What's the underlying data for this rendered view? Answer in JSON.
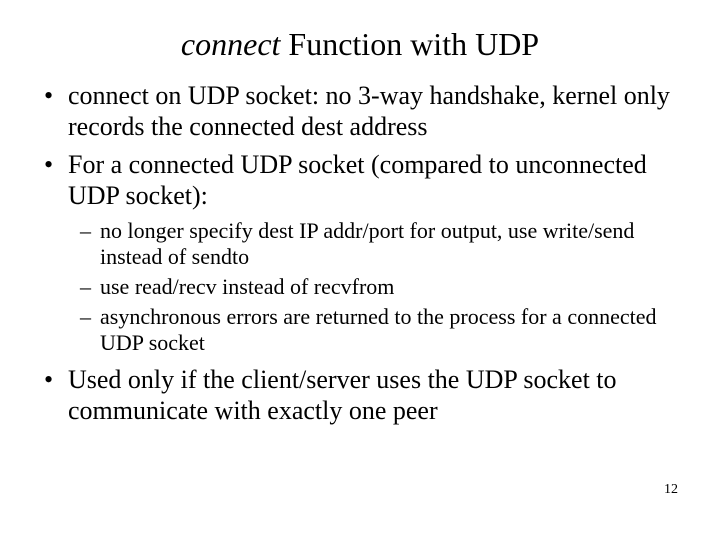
{
  "title": {
    "italic": "connect",
    "rest": " Function with UDP"
  },
  "bullets": {
    "b1": "connect on UDP socket: no 3-way handshake, kernel only records the connected dest address",
    "b2": "For a connected UDP socket (compared to unconnected UDP socket):",
    "b2_sub": {
      "s1": "no longer specify dest IP addr/port for output, use write/send instead of sendto",
      "s2": "use read/recv instead of recvfrom",
      "s3": "asynchronous errors are returned to the process for a connected UDP socket"
    },
    "b3": "Used only if the client/server uses the UDP socket to communicate with exactly one peer"
  },
  "page_number": "12"
}
